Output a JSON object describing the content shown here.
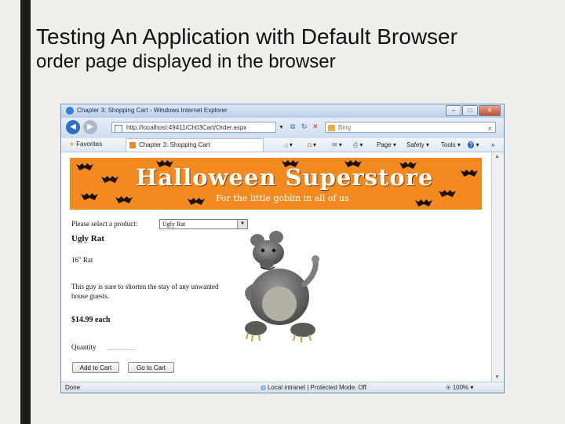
{
  "slide": {
    "title": "Testing An Application with Default Browser",
    "subtitle": "order page displayed in the browser"
  },
  "browser": {
    "window_title": "Chapter 3: Shopping Cart - Windows Internet Explorer",
    "address": "http://localhost:49411/Ch03Cart/Order.aspx",
    "search_placeholder": "Bing",
    "favorites_label": "Favorites",
    "tab_title": "Chapter 3: Shopping Cart",
    "commands": [
      "Page",
      "Safety",
      "Tools"
    ],
    "status_text": "Done",
    "zone_text": "Local intranet | Protected Mode: Off",
    "zoom_text": "100%"
  },
  "page": {
    "banner_title": "Halloween Superstore",
    "banner_subtitle": "For the little goblin in all of us",
    "select_label": "Please select a product:",
    "selected_product": "Ugly Rat",
    "product_name": "Ugly Rat",
    "short_description": "16\" Rat",
    "long_description": "This guy is sure to shorten the stay of any unwanted house guests.",
    "price": "$14.99 each",
    "quantity_label": "Quantity",
    "quantity_value": "",
    "add_button": "Add to Cart",
    "go_button": "Go to Cart"
  },
  "icons": {
    "back": "back-arrow-icon",
    "forward": "forward-arrow-icon",
    "refresh": "refresh-icon",
    "stop": "stop-icon",
    "search": "magnifier-icon",
    "favorites": "star-icon",
    "home": "home-icon",
    "feeds": "rss-icon",
    "mail": "mail-icon",
    "print": "print-icon",
    "help": "help-icon",
    "globe": "globe-icon"
  },
  "colors": {
    "banner_orange": "#f28a20",
    "title_bar": "#b9cfe9"
  }
}
